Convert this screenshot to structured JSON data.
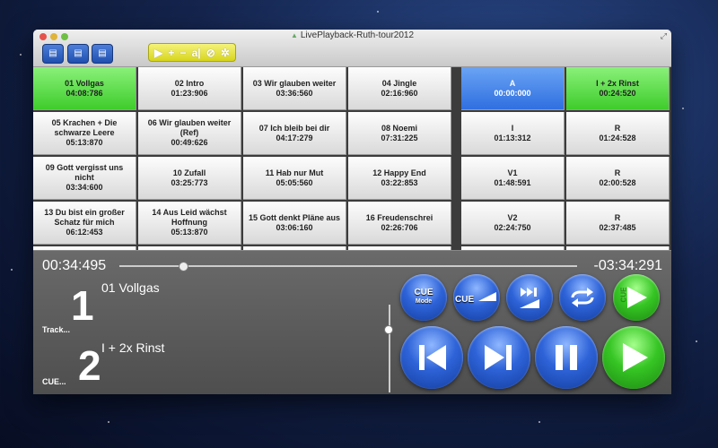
{
  "window": {
    "title": "LivePlayback-Ruth-tour2012"
  },
  "toolbar": {
    "buttons": [
      "open-document-icon",
      "save-document-icon",
      "export-document-icon"
    ],
    "edit_group": [
      "play-icon",
      "plus-icon",
      "minus-icon",
      "text-edit-icon",
      "disable-icon",
      "gear-icon"
    ]
  },
  "tracks": [
    {
      "name": "01 Vollgas",
      "time": "04:08:786"
    },
    {
      "name": "02 Intro",
      "time": "01:23:906"
    },
    {
      "name": "03 Wir glauben weiter",
      "time": "03:36:560"
    },
    {
      "name": "04 Jingle",
      "time": "02:16:960"
    },
    {
      "name": "05 Krachen + Die schwarze Leere",
      "time": "05:13:870"
    },
    {
      "name": "06 Wir glauben weiter (Ref)",
      "time": "00:49:626"
    },
    {
      "name": "07 Ich bleib bei dir",
      "time": "04:17:279"
    },
    {
      "name": "08 Noemi",
      "time": "07:31:225"
    },
    {
      "name": "09 Gott vergisst uns nicht",
      "time": "03:34:600"
    },
    {
      "name": "10 Zufall",
      "time": "03:25:773"
    },
    {
      "name": "11 Hab nur Mut",
      "time": "05:05:560"
    },
    {
      "name": "12 Happy End",
      "time": "03:22:853"
    },
    {
      "name": "13 Du bist ein großer Schatz für mich",
      "time": "06:12:453"
    },
    {
      "name": "14 Aus Leid wächst Hoffnung",
      "time": "05:13:870"
    },
    {
      "name": "15 Gott denkt Pläne aus",
      "time": "03:06:160"
    },
    {
      "name": "16 Freudenschrei",
      "time": "02:26:706"
    }
  ],
  "cues": [
    {
      "name": "A",
      "time": "00:00:000"
    },
    {
      "name": "I + 2x Rinst",
      "time": "00:24:520"
    },
    {
      "name": "I",
      "time": "01:13:312"
    },
    {
      "name": "R",
      "time": "01:24:528"
    },
    {
      "name": "V1",
      "time": "01:48:591"
    },
    {
      "name": "R",
      "time": "02:00:528"
    },
    {
      "name": "V2",
      "time": "02:24:750"
    },
    {
      "name": "R",
      "time": "02:37:485"
    }
  ],
  "transport": {
    "elapsed": "00:34:495",
    "remaining": "-03:34:291",
    "progress": 0.14,
    "track_number": "1",
    "track_name": "01 Vollgas",
    "track_label": "Track...",
    "cue_number": "2",
    "cue_name": "I + 2x Rinst",
    "cue_label": "CUE...",
    "cue_mode_label": "CUE",
    "cue_mode_sub": "Mode",
    "cue_fade_label": "CUE",
    "cue_play_label": "CUE"
  },
  "colors": {
    "active_green": "#3fcc2c",
    "selected_blue": "#2f6fe0",
    "button_blue": "#2e63d8"
  }
}
